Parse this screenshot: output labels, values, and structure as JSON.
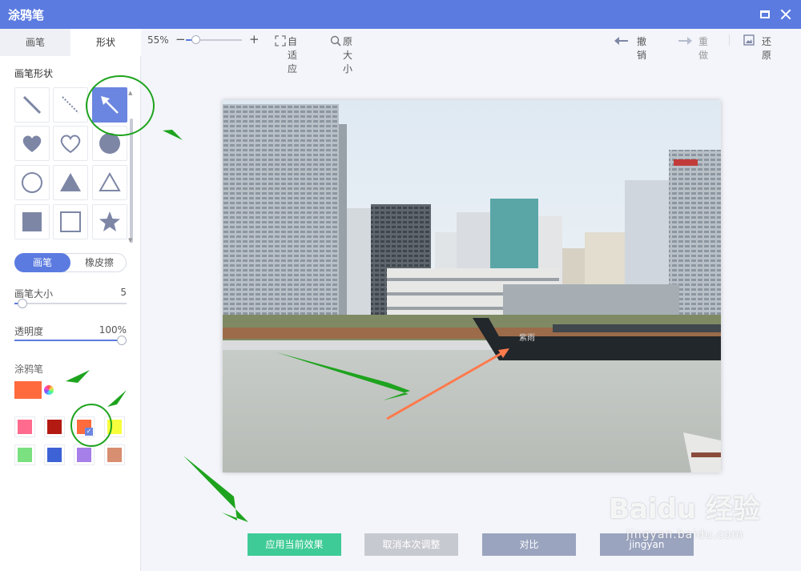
{
  "window": {
    "title": "涂鸦笔"
  },
  "tabs": [
    {
      "label": "画笔"
    },
    {
      "label": "形状"
    }
  ],
  "sidebar": {
    "shape_section": "画笔形状",
    "shapes": [
      {
        "name": "line",
        "active": false
      },
      {
        "name": "dashed-line",
        "active": false
      },
      {
        "name": "arrow",
        "active": true
      },
      {
        "name": "heart-filled",
        "active": false
      },
      {
        "name": "heart-outline",
        "active": false
      },
      {
        "name": "circle-filled",
        "active": false
      },
      {
        "name": "circle-outline",
        "active": false
      },
      {
        "name": "triangle-filled",
        "active": false
      },
      {
        "name": "triangle-outline",
        "active": false
      },
      {
        "name": "square-filled",
        "active": false
      },
      {
        "name": "square-outline",
        "active": false
      },
      {
        "name": "star-filled",
        "active": false
      }
    ],
    "mode_brush": "画笔",
    "mode_eraser": "橡皮擦",
    "brush_size_label": "画笔大小",
    "brush_size_value": "5",
    "opacity_label": "透明度",
    "opacity_value": "100%",
    "doodle_label": "涂鸦笔",
    "current_color": "#ff6b3d",
    "swatches": [
      {
        "color": "#ff6b8e",
        "selected": false
      },
      {
        "color": "#b31a12",
        "selected": false
      },
      {
        "color": "#ff6b3d",
        "selected": true
      },
      {
        "color": "#f7ff3d",
        "selected": false
      },
      {
        "color": "#7ae080",
        "selected": false
      },
      {
        "color": "#3d62d6",
        "selected": false
      },
      {
        "color": "#a77fe8",
        "selected": false
      },
      {
        "color": "#d88e70",
        "selected": false
      }
    ]
  },
  "toolbar": {
    "zoom": "55%",
    "zoom_minus": "−",
    "zoom_plus": "+",
    "fit": "自适应",
    "original": "原大小",
    "undo": "撤销",
    "redo": "重做",
    "restore": "还原"
  },
  "photo": {
    "ship_name": "紫雨"
  },
  "buttons": {
    "apply": "应用当前效果",
    "cancel": "取消本次调整",
    "compare": "对比",
    "reset": "jingyan"
  },
  "watermark": {
    "brand": "Baidu 经验",
    "sub": "jingyan.baidu.com"
  },
  "colors": {
    "accent": "#5b7be0",
    "apply": "#3fcb97",
    "annotation": "#1ea31e"
  }
}
